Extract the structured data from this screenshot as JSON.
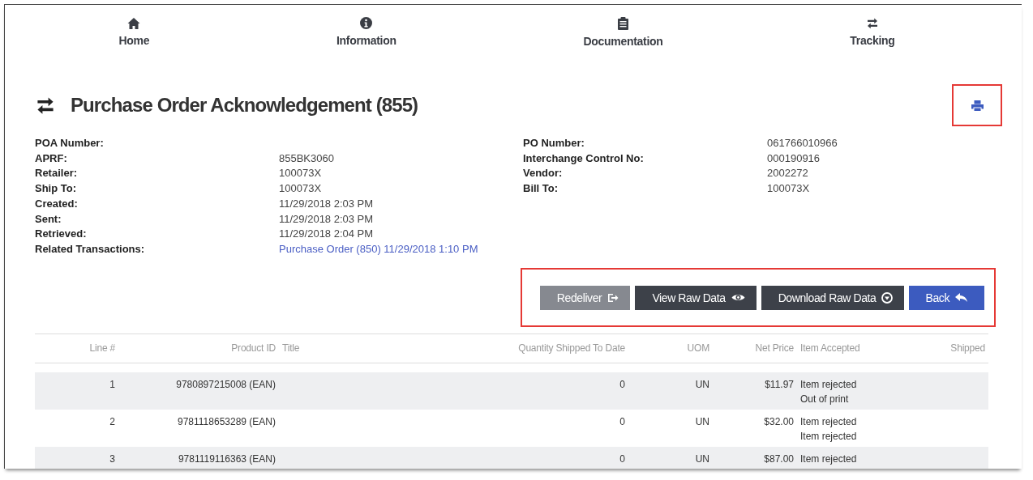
{
  "nav": [
    {
      "label": "Home"
    },
    {
      "label": "Information"
    },
    {
      "label": "Documentation"
    },
    {
      "label": "Tracking"
    }
  ],
  "title": "Purchase Order Acknowledgement (855)",
  "details_left": [
    {
      "label": "POA Number:"
    },
    {
      "label": "APRF:",
      "value": "855BK3060"
    },
    {
      "label": "Retailer:",
      "value": "100073X"
    },
    {
      "label": "Ship To:",
      "value": "100073X"
    },
    {
      "label": "Created:",
      "value": "11/29/2018 2:03 PM"
    },
    {
      "label": "Sent:",
      "value": "11/29/2018 2:03 PM"
    },
    {
      "label": "Retrieved:",
      "value": "11/29/2018 2:04 PM"
    },
    {
      "label": "Related Transactions:",
      "value": "Purchase Order (850) 11/29/2018 1:10 PM",
      "kind": "link"
    }
  ],
  "details_right": [
    {
      "label": "PO Number:",
      "value": "061766010966"
    },
    {
      "label": "Interchange Control No:",
      "value": "000190916"
    },
    {
      "label": "Vendor:",
      "value": "2002272"
    },
    {
      "label": "Bill To:",
      "value": "100073X"
    }
  ],
  "buttons": [
    {
      "label": "Redeliver",
      "kind": "muted"
    },
    {
      "label": "View Raw Data",
      "kind": "dark"
    },
    {
      "label": "Download Raw Data",
      "kind": "dark"
    },
    {
      "label": "Back",
      "kind": "primary"
    }
  ],
  "table": {
    "columns": [
      "Line #",
      "Product ID",
      "Title",
      "Quantity Shipped To Date",
      "UOM",
      "Net Price",
      "Item Accepted",
      "Shipped"
    ],
    "rows": [
      [
        "1",
        "9780897215008 (EAN)",
        null,
        "0",
        "UN",
        "$11.97",
        [
          "Item rejected",
          "Out of print"
        ],
        null
      ],
      [
        "2",
        "9781118653289 (EAN)",
        null,
        "0",
        "UN",
        "$32.00",
        [
          "Item rejected",
          "Item rejected"
        ],
        null
      ],
      [
        "3",
        "9781119116363 (EAN)",
        null,
        "0",
        "UN",
        "$87.00",
        [
          "Item rejected"
        ],
        null
      ]
    ]
  }
}
